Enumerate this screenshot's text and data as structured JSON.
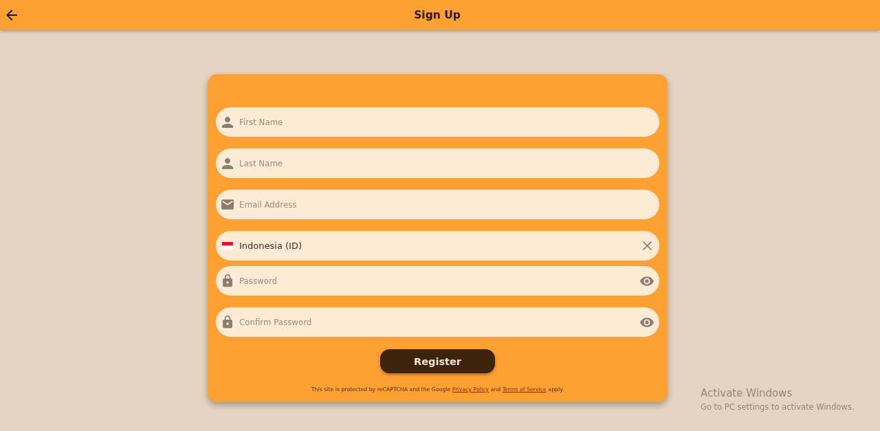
{
  "app_bar": {
    "title": "Sign Up"
  },
  "form": {
    "fields": [
      {
        "kind": "name",
        "placeholder": "First Name"
      },
      {
        "kind": "name",
        "placeholder": "Last Name"
      },
      {
        "kind": "email",
        "placeholder": "Email Address"
      },
      {
        "kind": "country",
        "value": "Indonesia (ID)"
      },
      {
        "kind": "password",
        "placeholder": "Password"
      },
      {
        "kind": "password",
        "placeholder": "Confirm Password"
      }
    ],
    "submit_button": "Register",
    "notice": [
      {
        "kind": "text",
        "text": "This site is protected by reCAPTCHA and the Google "
      },
      {
        "kind": "link",
        "text": "Privacy Policy"
      },
      {
        "kind": "text",
        "text": " and "
      },
      {
        "kind": "link",
        "text": "Terms of Service"
      },
      {
        "kind": "text",
        "text": " apply."
      }
    ]
  },
  "system_overlay": {
    "title": "Activate Windows",
    "message": "Go to PC settings to activate Windows."
  }
}
